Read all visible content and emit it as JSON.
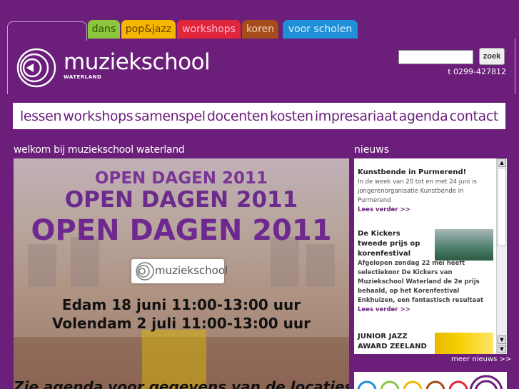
{
  "tabs": {
    "dans": "dans",
    "popjazz": "pop&jazz",
    "workshops": "workshops",
    "koren": "koren",
    "scholen": "voor scholen"
  },
  "logo": {
    "name": "muziekschool",
    "sub": "WATERLAND"
  },
  "search": {
    "button": "zoek",
    "placeholder": ""
  },
  "phone": "t 0299-427812",
  "nav": [
    "lessen",
    "workshops",
    "samenspel",
    "docenten",
    "kosten",
    "impresariaat",
    "agenda",
    "contact"
  ],
  "welcome": "welkom bij muziekschool waterland",
  "banner": {
    "line1": "OPEN DAGEN 2011",
    "line2": "OPEN DAGEN 2011",
    "line3": "OPEN DAGEN 2011",
    "logo_text": "muziekschool",
    "date1": "Edam 18 juni 11:00-13:00 uur",
    "date2": "Volendam 2 juli 11:00-13:00 uur",
    "bottom": "Zie agenda voor gegevens van de locaties"
  },
  "news": {
    "title": "nieuws",
    "items": [
      {
        "title": "Kunstbende in Purmerend!",
        "body": "In de week van 20 tot en met 24 juni is jongerenorganisatie Kunstbende in Purmerend",
        "more": "Lees verder >>"
      },
      {
        "title": "De Kickers tweede prijs op korenfestival",
        "body": "Afgelopen zondag 22 mei heeft selectiekoor De Kickers van Muziekschool Waterland de 2e prijs behaald, op het Korenfestival Enkhuizen, een fantastisch resultaat",
        "more": "Lees verder >>"
      },
      {
        "title": "JUNIOR JAZZ AWARD ZEELAND",
        "body": "",
        "more": ""
      }
    ],
    "more_news": "meer nieuws >>"
  },
  "colors": {
    "background": "#6b1f7a",
    "accent": "#6b1f7a"
  }
}
